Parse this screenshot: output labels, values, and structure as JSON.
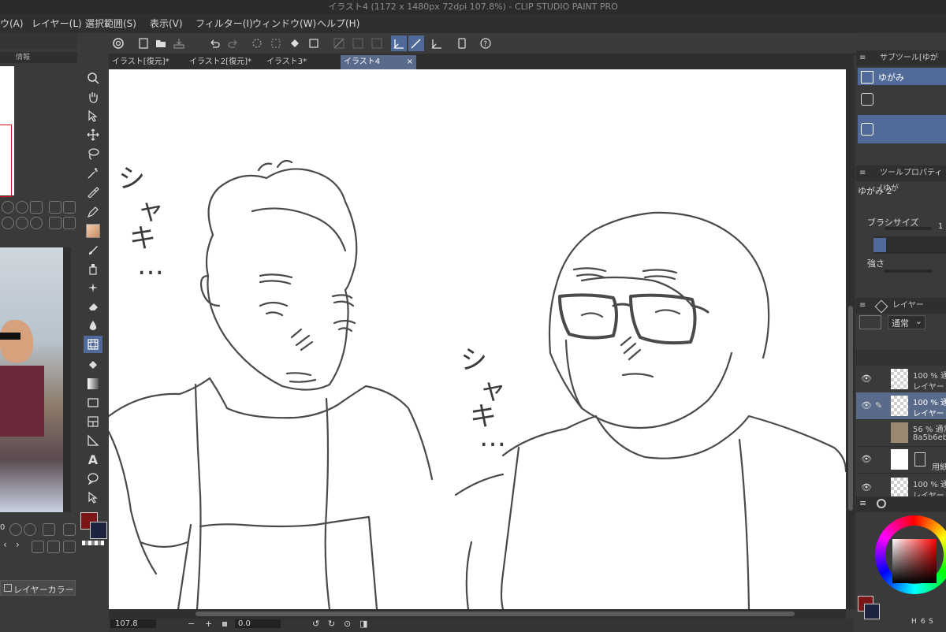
{
  "window": {
    "title": "イラスト4 (1172 x 1480px 72dpi 107.8%)  - CLIP STUDIO PAINT PRO"
  },
  "menu": [
    {
      "label": "ウ(A)"
    },
    {
      "label": "レイヤー(L)"
    },
    {
      "label": "選択範囲(S)"
    },
    {
      "label": "表示(V)"
    },
    {
      "label": "フィルター(I)"
    },
    {
      "label": "ウィンドウ(W)"
    },
    {
      "label": "ヘルプ(H)"
    }
  ],
  "left_panel": {
    "tab_label": "情報",
    "layer_color_button": "レイヤーカラー",
    "zoom_prefix": "0"
  },
  "tabs": [
    {
      "label": "イラスト[復元]*"
    },
    {
      "label": "イラスト2[復元]*"
    },
    {
      "label": "イラスト3*"
    },
    {
      "label": "イラスト4"
    }
  ],
  "canvas": {
    "text_left": [
      "シ",
      "ャ",
      "キ",
      "…"
    ],
    "text_right": [
      "シ",
      "ャ",
      "キ",
      "…"
    ]
  },
  "bottom_bar": {
    "zoom": "107.8",
    "rotation": "0.0"
  },
  "sub_tool": {
    "header": "サブツール[ゆがみ]",
    "items": [
      "ゆがみ",
      "",
      ""
    ]
  },
  "tool_property": {
    "header": "ツールプロパティ[ゆが",
    "tool_name": "ゆがみ 2",
    "brush_size_label": "ブラシサイズ",
    "brush_size_value": "1",
    "strength_label": "強さ"
  },
  "layers": {
    "header": "レイヤー",
    "blend_mode": "通常",
    "rows": [
      {
        "line1": "100 % 通",
        "line2": "レイヤー"
      },
      {
        "line1": "100 % 通",
        "line2": "レイヤー"
      },
      {
        "line1": "56 % 通常",
        "line2": "8a5b6eb"
      },
      {
        "line1": "",
        "line2": "用紙"
      },
      {
        "line1": "100 % 通",
        "line2": "レイヤー"
      }
    ]
  },
  "color": {
    "main": "#7a1518",
    "sub": "#1c2440",
    "hsv": [
      "H",
      "6",
      "S"
    ]
  }
}
